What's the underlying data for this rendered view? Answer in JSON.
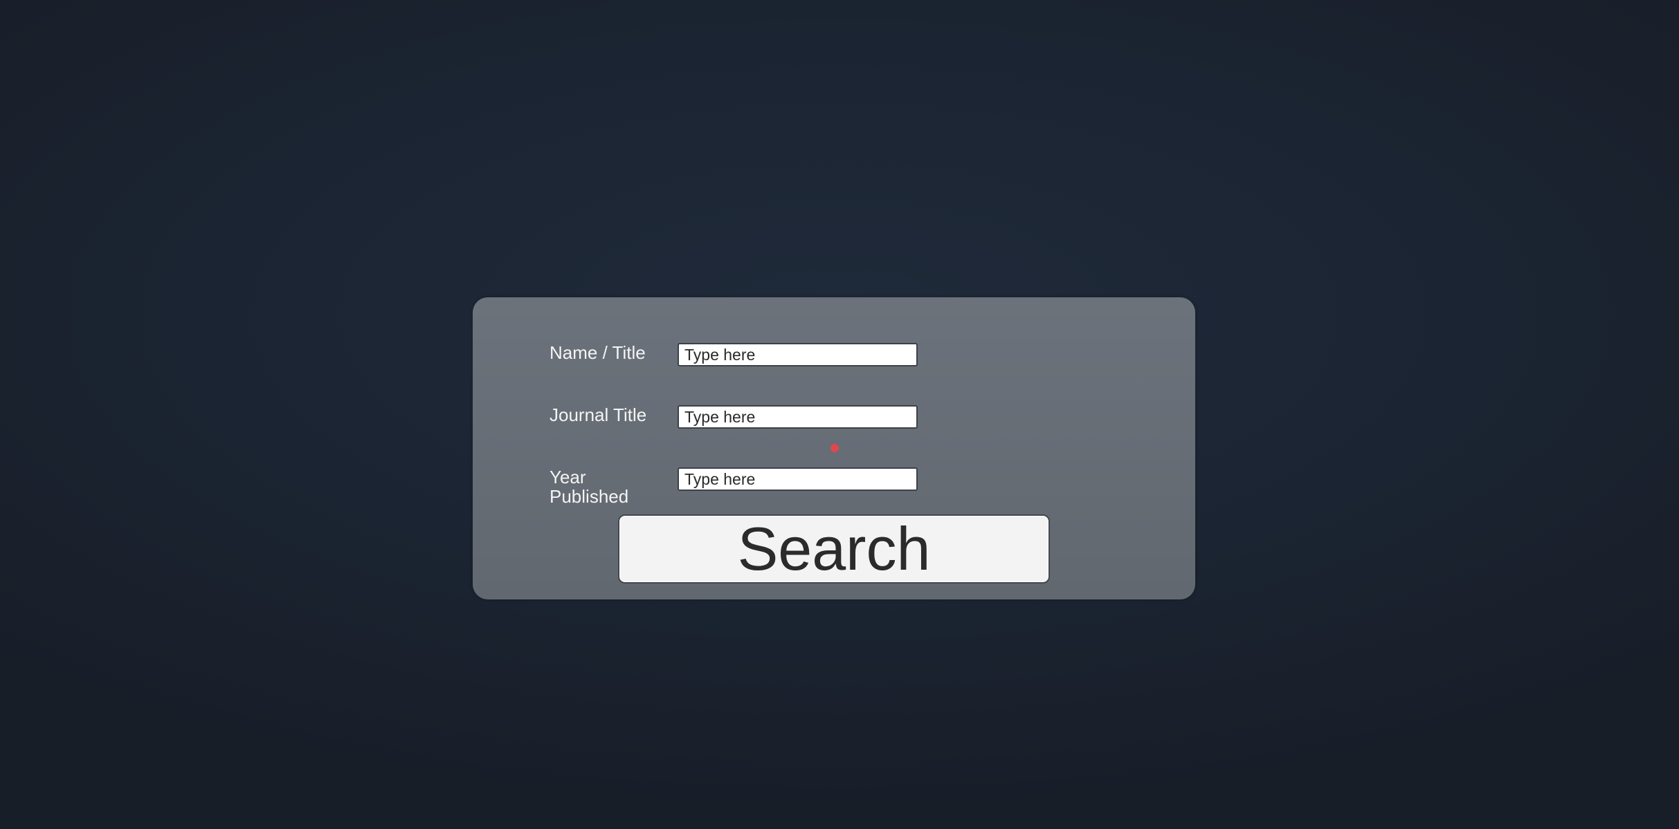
{
  "form": {
    "fields": [
      {
        "label": "Name / Title",
        "placeholder": "Type here"
      },
      {
        "label": "Journal Title",
        "placeholder": "Type here"
      },
      {
        "label": "Year Published",
        "placeholder": "Type here"
      }
    ],
    "search_label": "Search"
  },
  "colors": {
    "panel": "#676d76",
    "background": "#1c2533",
    "cursor_dot": "#e0474c"
  }
}
